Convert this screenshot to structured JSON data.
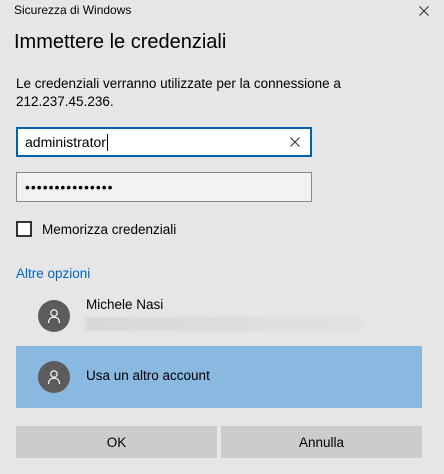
{
  "window": {
    "app_title": "Sicurezza di Windows"
  },
  "dialog": {
    "heading": "Immettere le credenziali",
    "message": "Le credenziali verranno utilizzate per la connessione a 212.237.45.236."
  },
  "form": {
    "username_value": "administrator",
    "password_masked": "•••••••••••••••",
    "remember_label": "Memorizza credenziali",
    "remember_checked": false
  },
  "more_options": {
    "label": "Altre opzioni",
    "color": "#0067c0"
  },
  "accounts": [
    {
      "name": "Michele Nasi",
      "selected": false
    },
    {
      "name": "Usa un altro account",
      "selected": true,
      "highlight_color": "#89b8e0"
    }
  ],
  "buttons": {
    "ok_label": "OK",
    "cancel_label": "Annulla"
  },
  "icons": {
    "close": "close-icon",
    "clear": "clear-x-icon",
    "avatar": "person-icon"
  }
}
